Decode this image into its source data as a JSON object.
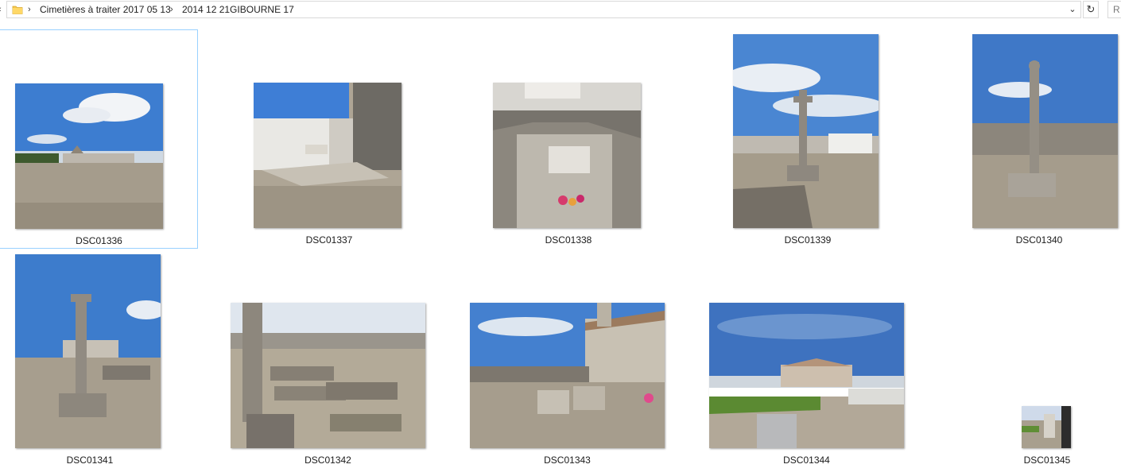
{
  "address_bar": {
    "breadcrumbs": [
      "Cimetières à traiter 2017 05 13",
      "2014 12 21GIBOURNE 17"
    ],
    "search_placeholder": "R"
  },
  "files": [
    {
      "name": "DSC01336",
      "selected": true
    },
    {
      "name": "DSC01337"
    },
    {
      "name": "DSC01338"
    },
    {
      "name": "DSC01339"
    },
    {
      "name": "DSC01340"
    },
    {
      "name": "DSC01341"
    },
    {
      "name": "DSC01342"
    },
    {
      "name": "DSC01343"
    },
    {
      "name": "DSC01344"
    },
    {
      "name": "DSC01345"
    }
  ],
  "colors": {
    "selection_border": "#99d1ff",
    "sky": "#3f78c7",
    "gravel": "#a59c8c",
    "stone": "#cfcac0"
  }
}
